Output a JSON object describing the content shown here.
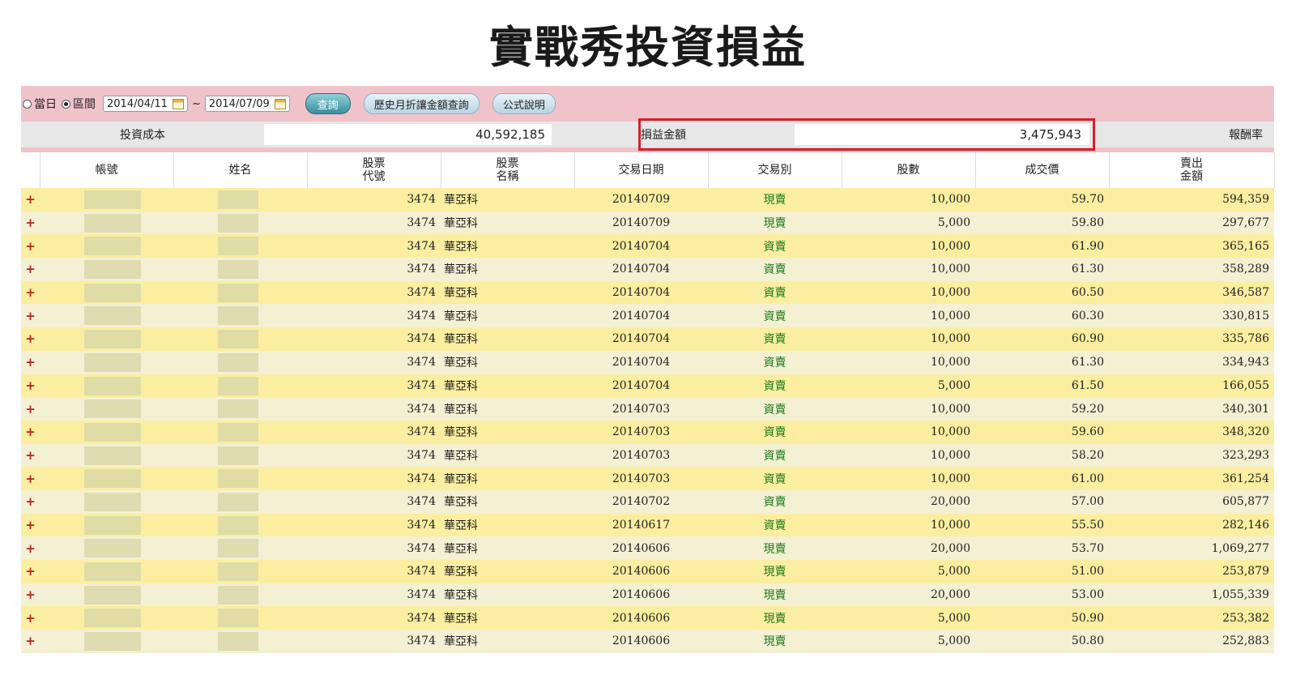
{
  "title": "實戰秀投資損益",
  "filter": {
    "radio_today": "當日",
    "radio_range": "區間",
    "date_from": "2014/04/11",
    "date_to": "2014/07/09",
    "separator": "~",
    "query_button": "查詢",
    "history_button": "歷史月折讓金額查詢",
    "formula_button": "公式說明"
  },
  "summary": {
    "cost_label": "投資成本",
    "cost_value": "40,592,185",
    "pl_label": "損益金額",
    "pl_value": "3,475,943",
    "return_label": "報酬率"
  },
  "table": {
    "headers": {
      "account": "帳號",
      "name": "姓名",
      "code_1": "股票",
      "code_2": "代號",
      "stock_1": "股票",
      "stock_2": "名稱",
      "date": "交易日期",
      "type": "交易別",
      "shares": "股數",
      "price": "成交價",
      "amount_1": "賣出",
      "amount_2": "金額"
    },
    "rows": [
      {
        "code": "3474",
        "stock": "華亞科",
        "date": "20140709",
        "type": "現賣",
        "shares": "10,000",
        "price": "59.70",
        "amount": "594,359"
      },
      {
        "code": "3474",
        "stock": "華亞科",
        "date": "20140709",
        "type": "現賣",
        "shares": "5,000",
        "price": "59.80",
        "amount": "297,677"
      },
      {
        "code": "3474",
        "stock": "華亞科",
        "date": "20140704",
        "type": "資賣",
        "shares": "10,000",
        "price": "61.90",
        "amount": "365,165"
      },
      {
        "code": "3474",
        "stock": "華亞科",
        "date": "20140704",
        "type": "資賣",
        "shares": "10,000",
        "price": "61.30",
        "amount": "358,289"
      },
      {
        "code": "3474",
        "stock": "華亞科",
        "date": "20140704",
        "type": "資賣",
        "shares": "10,000",
        "price": "60.50",
        "amount": "346,587"
      },
      {
        "code": "3474",
        "stock": "華亞科",
        "date": "20140704",
        "type": "資賣",
        "shares": "10,000",
        "price": "60.30",
        "amount": "330,815"
      },
      {
        "code": "3474",
        "stock": "華亞科",
        "date": "20140704",
        "type": "資賣",
        "shares": "10,000",
        "price": "60.90",
        "amount": "335,786"
      },
      {
        "code": "3474",
        "stock": "華亞科",
        "date": "20140704",
        "type": "資賣",
        "shares": "10,000",
        "price": "61.30",
        "amount": "334,943"
      },
      {
        "code": "3474",
        "stock": "華亞科",
        "date": "20140704",
        "type": "資賣",
        "shares": "5,000",
        "price": "61.50",
        "amount": "166,055"
      },
      {
        "code": "3474",
        "stock": "華亞科",
        "date": "20140703",
        "type": "資賣",
        "shares": "10,000",
        "price": "59.20",
        "amount": "340,301"
      },
      {
        "code": "3474",
        "stock": "華亞科",
        "date": "20140703",
        "type": "資賣",
        "shares": "10,000",
        "price": "59.60",
        "amount": "348,320"
      },
      {
        "code": "3474",
        "stock": "華亞科",
        "date": "20140703",
        "type": "資賣",
        "shares": "10,000",
        "price": "58.20",
        "amount": "323,293"
      },
      {
        "code": "3474",
        "stock": "華亞科",
        "date": "20140703",
        "type": "資賣",
        "shares": "10,000",
        "price": "61.00",
        "amount": "361,254"
      },
      {
        "code": "3474",
        "stock": "華亞科",
        "date": "20140702",
        "type": "資賣",
        "shares": "20,000",
        "price": "57.00",
        "amount": "605,877"
      },
      {
        "code": "3474",
        "stock": "華亞科",
        "date": "20140617",
        "type": "資賣",
        "shares": "10,000",
        "price": "55.50",
        "amount": "282,146"
      },
      {
        "code": "3474",
        "stock": "華亞科",
        "date": "20140606",
        "type": "現賣",
        "shares": "20,000",
        "price": "53.70",
        "amount": "1,069,277"
      },
      {
        "code": "3474",
        "stock": "華亞科",
        "date": "20140606",
        "type": "現賣",
        "shares": "5,000",
        "price": "51.00",
        "amount": "253,879"
      },
      {
        "code": "3474",
        "stock": "華亞科",
        "date": "20140606",
        "type": "現賣",
        "shares": "20,000",
        "price": "53.00",
        "amount": "1,055,339"
      },
      {
        "code": "3474",
        "stock": "華亞科",
        "date": "20140606",
        "type": "現賣",
        "shares": "5,000",
        "price": "50.90",
        "amount": "253,382"
      },
      {
        "code": "3474",
        "stock": "華亞科",
        "date": "20140606",
        "type": "現賣",
        "shares": "5,000",
        "price": "50.80",
        "amount": "252,883"
      }
    ]
  },
  "colors": {
    "toolbar_bg": "#f0c3cb",
    "row_odd": "#fbeea0",
    "row_even": "#f3f0d3",
    "highlight": "#d6202a"
  }
}
